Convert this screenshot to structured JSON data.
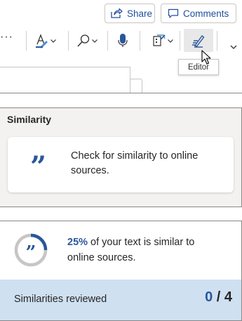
{
  "toolbar": {
    "share_label": "Share",
    "comments_label": "Comments",
    "more_label": "···",
    "editor_tooltip": "Editor"
  },
  "icons": {
    "share": "share-icon",
    "comments": "comment-icon",
    "font_color": "font-color-icon",
    "find": "search-icon",
    "dictate": "microphone-icon",
    "sensitivity": "sensitivity-icon",
    "editor": "editor-pen-icon",
    "expand": "chevron-down-icon"
  },
  "similarity": {
    "title": "Similarity",
    "card_text": "Check for similarity to online sources."
  },
  "result": {
    "percent_label": "25%",
    "percent_value": 0.25,
    "text": " of your text is similar to online sources.",
    "reviewed_label": "Similarities reviewed",
    "reviewed_count": "0",
    "separator": " / ",
    "total_count": "4"
  },
  "colors": {
    "accent": "#2b579a",
    "progress_track": "#c8c6c4",
    "reviewed_bar": "#cfe0f1",
    "panel_gray": "#f3f2f1"
  }
}
